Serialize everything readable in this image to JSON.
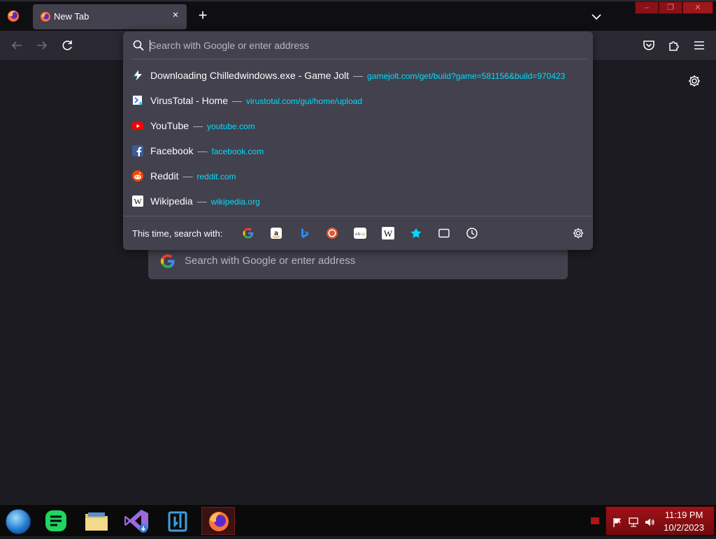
{
  "window": {
    "tab_title": "New Tab",
    "tab_close": "×",
    "new_tab": "+"
  },
  "urlbar": {
    "placeholder": "Search with Google or enter address",
    "suggestions": [
      {
        "title": "Downloading Chilledwindows.exe - Game Jolt",
        "url": "gamejolt.com/get/build?game=581156&build=970423",
        "icon": "gamejolt-icon"
      },
      {
        "title": "VirusTotal - Home",
        "url": "virustotal.com/gui/home/upload",
        "icon": "virustotal-icon"
      },
      {
        "title": "YouTube",
        "url": "youtube.com",
        "icon": "youtube-icon"
      },
      {
        "title": "Facebook",
        "url": "facebook.com",
        "icon": "facebook-icon"
      },
      {
        "title": "Reddit",
        "url": "reddit.com",
        "icon": "reddit-icon"
      },
      {
        "title": "Wikipedia",
        "url": "wikipedia.org",
        "icon": "wikipedia-icon"
      }
    ],
    "separator": "—",
    "oneoff_label": "This time, search with:",
    "engines": [
      "google-icon",
      "amazon-icon",
      "bing-icon",
      "duckduckgo-icon",
      "ebay-icon",
      "wikipedia-icon",
      "bookmarks-icon",
      "tabs-icon",
      "history-icon"
    ]
  },
  "content": {
    "search_placeholder": "Search with Google or enter address"
  },
  "taskbar": {
    "time": "11:19 PM",
    "date": "10/2/2023"
  },
  "colors": {
    "accent_url": "#00ddff",
    "panel": "#42414d",
    "background": "#1c1b22",
    "tray": "#a01218"
  }
}
